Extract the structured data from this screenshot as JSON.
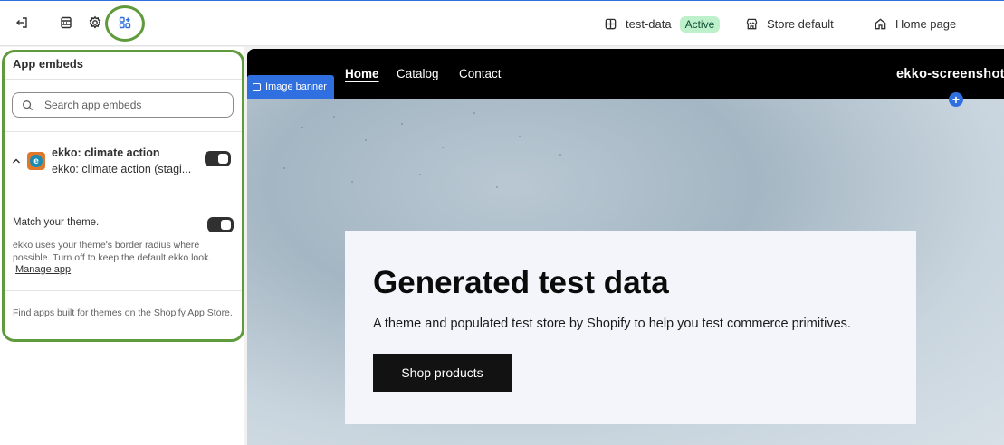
{
  "topbar": {
    "theme_name": "test-data",
    "theme_status": "Active",
    "store_label": "Store default",
    "page_label": "Home page"
  },
  "sidebar": {
    "title": "App embeds",
    "search_placeholder": "Search app embeds",
    "app": {
      "name": "ekko: climate action",
      "subtitle": "ekko: climate action (stagi...",
      "enabled": true
    },
    "match_theme": {
      "label": "Match your theme.",
      "help": "ekko uses your theme's border radius where possible. Turn off to keep the default ekko look.",
      "enabled": true
    },
    "manage_link": "Manage app",
    "footer_text": "Find apps built for themes on the ",
    "footer_link": "Shopify App Store",
    "footer_end": "."
  },
  "preview": {
    "nav": [
      "Home",
      "Catalog",
      "Contact"
    ],
    "store_name": "ekko-screenshot",
    "section_tag": "Image banner",
    "hero_title": "Generated test data",
    "hero_subtitle": "A theme and populated test store by Shopify to help you test commerce primitives.",
    "hero_button": "Shop products"
  },
  "colors": {
    "accent": "#2f6fe0",
    "highlight_ring": "#5f9a3c",
    "active_badge": "#bff0cc"
  },
  "icons": [
    "exit-icon",
    "sections-icon",
    "gear-icon",
    "apps-icon",
    "theme-icon",
    "store-icon",
    "home-icon",
    "search-icon",
    "chevron-up-icon",
    "add-icon"
  ]
}
